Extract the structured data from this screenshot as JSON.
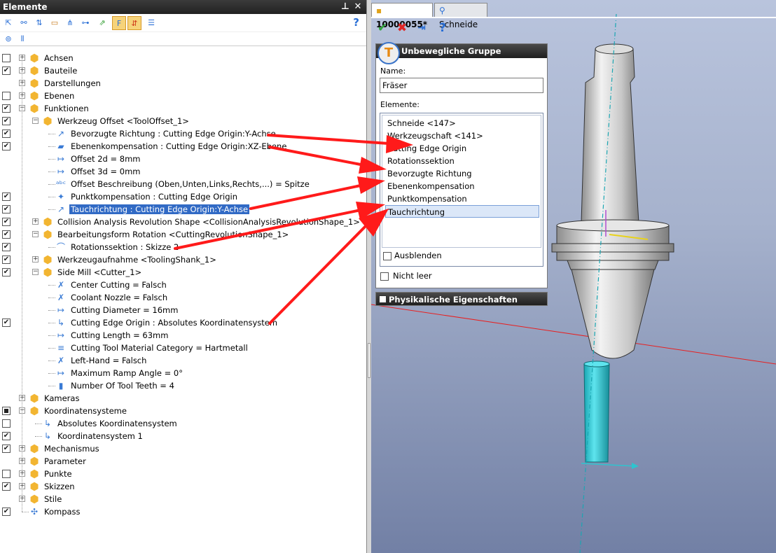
{
  "left_panel": {
    "title": "Elemente",
    "pin_icon": "pin-icon",
    "close_icon": "close-icon",
    "help": "?"
  },
  "tree": [
    {
      "label": "Achsen",
      "level": 0,
      "check": "unchecked",
      "expand": "+",
      "icon": "cube"
    },
    {
      "label": "Bauteile",
      "level": 0,
      "check": "checked",
      "expand": "+",
      "icon": "cube"
    },
    {
      "label": "Darstellungen",
      "level": 0,
      "check": "none",
      "expand": "+",
      "icon": "cube"
    },
    {
      "label": "Ebenen",
      "level": 0,
      "check": "unchecked",
      "expand": "+",
      "icon": "cube"
    },
    {
      "label": "Funktionen",
      "level": 0,
      "check": "checked",
      "expand": "−",
      "icon": "cube"
    },
    {
      "label": "Werkzeug Offset <ToolOffset_1>",
      "level": 1,
      "check": "checked",
      "expand": "−",
      "icon": "cube"
    },
    {
      "label": "Bevorzugte Richtung : Cutting Edge Origin:Y-Achse",
      "level": 2,
      "check": "checked",
      "expand": "",
      "icon": "dir"
    },
    {
      "label": "Ebenenkompensation : Cutting Edge Origin:XZ-Ebene",
      "level": 2,
      "check": "checked",
      "expand": "",
      "icon": "plane"
    },
    {
      "label": "Offset 2d = 8mm",
      "level": 2,
      "check": "none",
      "expand": "",
      "icon": "param"
    },
    {
      "label": "Offset 3d = 0mm",
      "level": 2,
      "check": "none",
      "expand": "",
      "icon": "param"
    },
    {
      "label": "Offset Beschreibung (Oben,Unten,Links,Rechts,...) = Spitze",
      "level": 2,
      "check": "none",
      "expand": "",
      "icon": "abc"
    },
    {
      "label": "Punktkompensation : Cutting Edge Origin",
      "level": 2,
      "check": "checked",
      "expand": "",
      "icon": "point"
    },
    {
      "label": "Tauchrichtung : Cutting Edge Origin:Y-Achse",
      "level": 2,
      "check": "checked",
      "expand": "",
      "icon": "dir",
      "selected": true
    },
    {
      "label": "Collision Analysis Revolution Shape <CollisionAnalysisRevolutionShape_1>",
      "level": 1,
      "check": "checked",
      "expand": "+",
      "icon": "cube"
    },
    {
      "label": "Bearbeitungsform Rotation <CuttingRevolutionShape_1>",
      "level": 1,
      "check": "checked",
      "expand": "−",
      "icon": "cube"
    },
    {
      "label": "Rotationssektion : Skizze 2",
      "level": 2,
      "check": "checked",
      "expand": "",
      "icon": "sketch"
    },
    {
      "label": "Werkzeugaufnahme <ToolingShank_1>",
      "level": 1,
      "check": "checked",
      "expand": "+",
      "icon": "cube"
    },
    {
      "label": "Side Mill <Cutter_1>",
      "level": 1,
      "check": "checked",
      "expand": "−",
      "icon": "cube"
    },
    {
      "label": "Center Cutting = Falsch",
      "level": 2,
      "check": "none",
      "expand": "",
      "icon": "bool"
    },
    {
      "label": "Coolant Nozzle = Falsch",
      "level": 2,
      "check": "none",
      "expand": "",
      "icon": "bool"
    },
    {
      "label": "Cutting Diameter = 16mm",
      "level": 2,
      "check": "none",
      "expand": "",
      "icon": "param"
    },
    {
      "label": "Cutting Edge Origin : Absolutes Koordinatensystem",
      "level": 2,
      "check": "checked",
      "expand": "",
      "icon": "coord"
    },
    {
      "label": "Cutting Length = 63mm",
      "level": 2,
      "check": "none",
      "expand": "",
      "icon": "param"
    },
    {
      "label": "Cutting Tool Material Category = Hartmetall",
      "level": 2,
      "check": "none",
      "expand": "",
      "icon": "list"
    },
    {
      "label": "Left-Hand = Falsch",
      "level": 2,
      "check": "none",
      "expand": "",
      "icon": "bool"
    },
    {
      "label": "Maximum Ramp Angle = 0°",
      "level": 2,
      "check": "none",
      "expand": "",
      "icon": "param"
    },
    {
      "label": "Number Of Tool Teeth = 4",
      "level": 2,
      "check": "none",
      "expand": "",
      "icon": "bars"
    },
    {
      "label": "Kameras",
      "level": 0,
      "check": "none",
      "expand": "+",
      "icon": "cube"
    },
    {
      "label": "Koordinatensysteme",
      "level": 0,
      "check": "mixed",
      "expand": "−",
      "icon": "cube"
    },
    {
      "label": "Absolutes Koordinatensystem",
      "level": 1,
      "check": "unchecked",
      "expand": "",
      "icon": "coord"
    },
    {
      "label": "Koordinatensystem 1",
      "level": 1,
      "check": "checked",
      "expand": "",
      "icon": "coord"
    },
    {
      "label": "Mechanismus",
      "level": 0,
      "check": "checked",
      "expand": "+",
      "icon": "cube"
    },
    {
      "label": "Parameter",
      "level": 0,
      "check": "none",
      "expand": "+",
      "icon": "cube"
    },
    {
      "label": "Punkte",
      "level": 0,
      "check": "unchecked",
      "expand": "+",
      "icon": "cube"
    },
    {
      "label": "Skizzen",
      "level": 0,
      "check": "checked",
      "expand": "+",
      "icon": "cube"
    },
    {
      "label": "Stile",
      "level": 0,
      "check": "none",
      "expand": "+",
      "icon": "cube"
    },
    {
      "label": "Kompass",
      "level": 0,
      "check": "checked",
      "expand": "",
      "icon": "compass"
    }
  ],
  "tabs": [
    {
      "label": "10000055*",
      "active": true,
      "icon": "part-icon"
    },
    {
      "label": "Schneide",
      "active": false,
      "icon": "tool-icon"
    }
  ],
  "right_toolbar": {
    "ok": "✔",
    "cancel": "✖",
    "help": "?"
  },
  "group_panel": {
    "title": "Unbewegliche Gruppe",
    "name_label": "Name:",
    "name_value": "Fräser",
    "elements_label": "Elemente:",
    "elements": [
      "Schneide <147>",
      "Werkzeugschaft <141>",
      "Cutting Edge Origin",
      "Rotationssektion",
      "Bevorzugte Richtung",
      "Ebenenkompensation",
      "Punktkompensation",
      "Tauchrichtung"
    ],
    "selected_index": 7,
    "hide_label": "Ausblenden",
    "not_empty_label": "Nicht leer"
  },
  "phys_panel": {
    "title": "Physikalische Eigenschaften"
  },
  "colors": {
    "accent_red": "#ff1a1a",
    "selection": "#316ac5",
    "cutter": "#2ec4cf",
    "body": "#cfcfcf"
  }
}
